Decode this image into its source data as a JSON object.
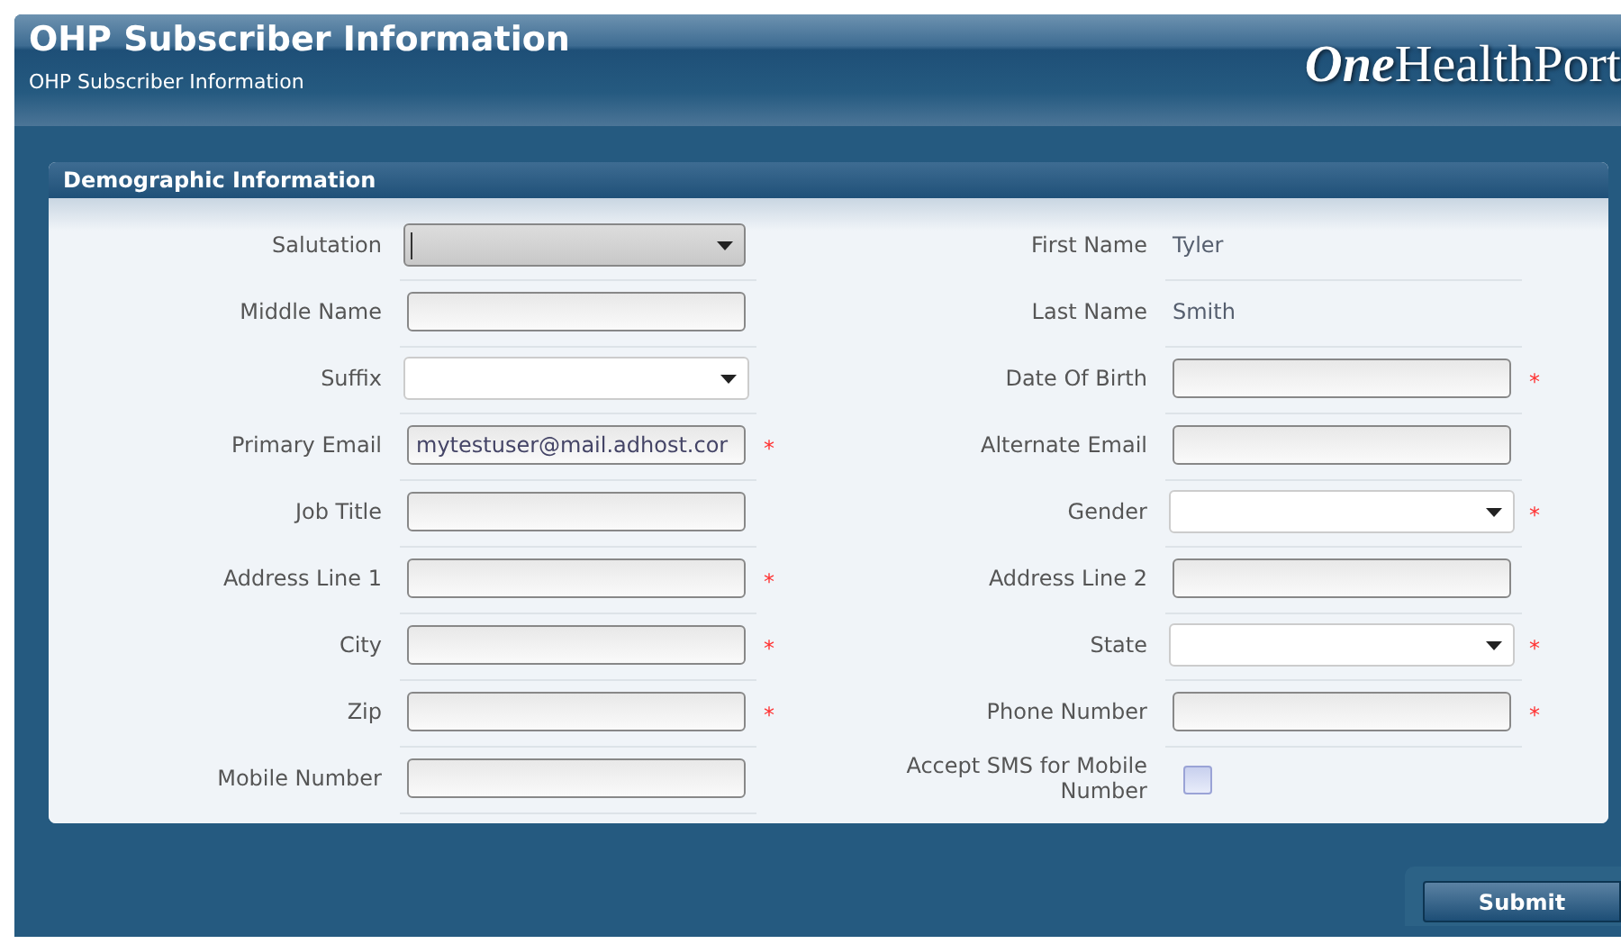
{
  "window": {
    "title": "OHP Subscriber Information",
    "subtitle": "OHP Subscriber Information",
    "logo": {
      "lead": "One",
      "rest": "HealthPort"
    }
  },
  "section": {
    "title": "Demographic Information"
  },
  "rows": [
    [
      {
        "label": "Salutation",
        "kind": "select",
        "focused": true
      },
      {
        "label": "First Name",
        "kind": "readonly",
        "value": "Tyler"
      }
    ],
    [
      {
        "label": "Middle Name",
        "kind": "text"
      },
      {
        "label": "Last Name",
        "kind": "readonly",
        "value": "Smith"
      }
    ],
    [
      {
        "label": "Suffix",
        "kind": "select",
        "focused": false
      },
      {
        "label": "Date Of Birth",
        "kind": "text",
        "required_mark": "*"
      }
    ],
    [
      {
        "label": "Primary Email",
        "kind": "text",
        "value": "mytestuser@mail.adhost.cor",
        "required_mark": "*"
      },
      {
        "label": "Alternate Email",
        "kind": "text"
      }
    ],
    [
      {
        "label": "Job Title",
        "kind": "text"
      },
      {
        "label": "Gender",
        "kind": "select",
        "focused": false,
        "required_mark": "*"
      }
    ],
    [
      {
        "label": "Address Line 1",
        "kind": "text",
        "required_mark": "*"
      },
      {
        "label": "Address Line 2",
        "kind": "text"
      }
    ],
    [
      {
        "label": "City",
        "kind": "text",
        "required_mark": "*"
      },
      {
        "label": "State",
        "kind": "select",
        "focused": false,
        "required_mark": "*"
      }
    ],
    [
      {
        "label": "Zip",
        "kind": "text",
        "required_mark": "*"
      },
      {
        "label": "Phone Number",
        "kind": "text",
        "required_mark": "*"
      }
    ],
    [
      {
        "label": "Mobile Number",
        "kind": "text"
      },
      {
        "label": "Accept SMS for Mobile Number",
        "kind": "checkbox",
        "checked": false
      }
    ]
  ],
  "buttons": [
    {
      "label": "Submit"
    }
  ]
}
